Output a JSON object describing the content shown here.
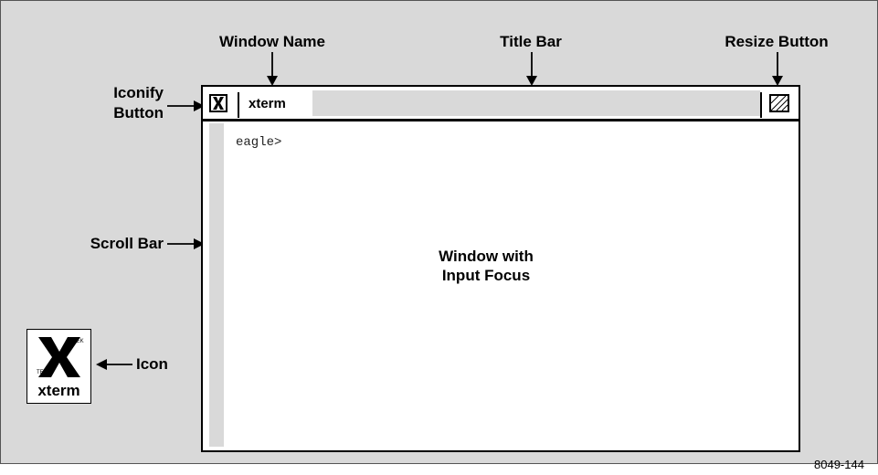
{
  "callouts": {
    "window_name": "Window Name",
    "title_bar": "Title Bar",
    "resize_button": "Resize Button",
    "iconify_line1": "Iconify",
    "iconify_line2": "Button",
    "scroll_bar": "Scroll Bar",
    "icon": "Icon"
  },
  "window": {
    "name": "xterm",
    "prompt": "eagle>",
    "focus_label_line1": "Window with",
    "focus_label_line2": "Input Focus"
  },
  "icon": {
    "label": "xterm",
    "badge_top": "TEK",
    "badge_bottom": "TEK"
  },
  "figure_number": "8049-144",
  "icons": [
    "iconify-x-icon",
    "resize-box-icon",
    "xterm-x-logo-icon",
    "left-arrow-icon",
    "down-arrow-icon"
  ],
  "colors": {
    "background": "#d9d9d9",
    "ink": "#000000",
    "window": "#ffffff"
  }
}
